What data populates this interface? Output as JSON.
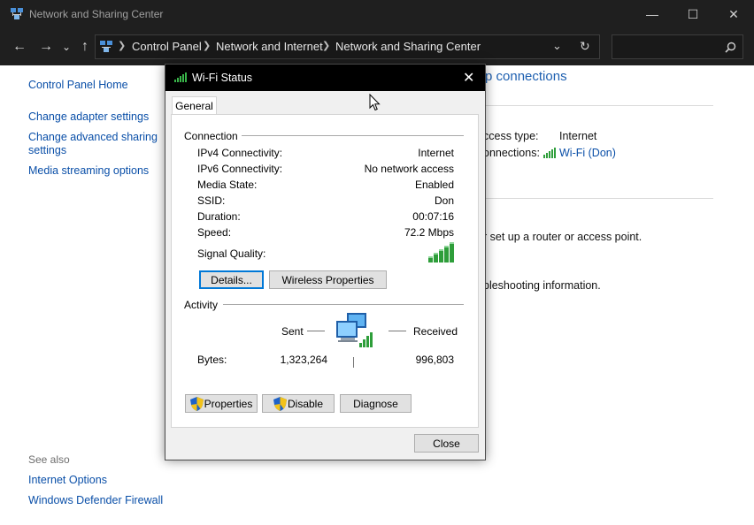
{
  "window": {
    "title": "Network and Sharing Center",
    "minimize": "—",
    "maximize": "☐",
    "close": "✕"
  },
  "nav": {
    "back": "←",
    "forward": "→",
    "recent": "⌄",
    "up": "↑",
    "breadcrumb": [
      "Control Panel",
      "Network and Internet",
      "Network and Sharing Center"
    ],
    "dropdown": "⌄",
    "refresh": "↻",
    "search_placeholder": ""
  },
  "sidebar": {
    "items": [
      "Control Panel Home",
      "Change adapter settings",
      "Change advanced sharing settings",
      "Media streaming options"
    ],
    "see_also_label": "See also",
    "see_also": [
      "Internet Options",
      "Windows Defender Firewall"
    ]
  },
  "main": {
    "heading_fragment": "p connections",
    "access_type_label": "ccess type:",
    "access_type_value": "Internet",
    "connections_label": "onnections:",
    "connections_value": "Wi-Fi (Don)",
    "router_text": "r set up a router or access point.",
    "troubleshoot_text": "bleshooting information."
  },
  "dialog": {
    "title": "Wi-Fi Status",
    "close": "✕",
    "tab": "General",
    "connection_group": "Connection",
    "rows": [
      {
        "label": "IPv4 Connectivity:",
        "value": "Internet"
      },
      {
        "label": "IPv6 Connectivity:",
        "value": "No network access"
      },
      {
        "label": "Media State:",
        "value": "Enabled"
      },
      {
        "label": "SSID:",
        "value": "Don"
      },
      {
        "label": "Duration:",
        "value": "00:07:16"
      },
      {
        "label": "Speed:",
        "value": "72.2 Mbps"
      }
    ],
    "signal_label": "Signal Quality:",
    "details_button": "Details...",
    "wireless_button": "Wireless Properties",
    "activity_group": "Activity",
    "sent_label": "Sent",
    "received_label": "Received",
    "bytes_label": "Bytes:",
    "bytes_sent": "1,323,264",
    "bytes_received": "996,803",
    "properties_button": "Properties",
    "disable_button": "Disable",
    "diagnose_button": "Diagnose",
    "close_button": "Close"
  },
  "colors": {
    "link": "#0a4fa8",
    "signal_green": "#2e9e3a",
    "titlebar": "#1f1f1f"
  }
}
